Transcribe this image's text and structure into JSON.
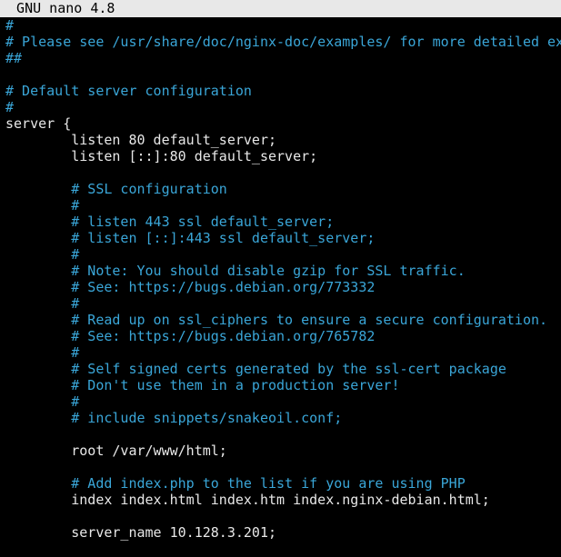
{
  "title_bar": {
    "text": "  GNU nano 4.8"
  },
  "colors": {
    "background": "#000000",
    "title_bar_bg": "#e8e8e8",
    "title_bar_fg": "#000000",
    "code_text": "#e8e8e8",
    "comment_text": "#3aa6d8"
  },
  "editor": {
    "lines": [
      {
        "text": "#",
        "type": "comment"
      },
      {
        "text": "# Please see /usr/share/doc/nginx-doc/examples/ for more detailed ex",
        "type": "comment"
      },
      {
        "text": "##",
        "type": "comment"
      },
      {
        "text": "",
        "type": "code"
      },
      {
        "text": "# Default server configuration",
        "type": "comment"
      },
      {
        "text": "#",
        "type": "comment"
      },
      {
        "text": "server {",
        "type": "code"
      },
      {
        "text": "        listen 80 default_server;",
        "type": "code"
      },
      {
        "text": "        listen [::]:80 default_server;",
        "type": "code"
      },
      {
        "text": "",
        "type": "code"
      },
      {
        "text": "        # SSL configuration",
        "type": "comment"
      },
      {
        "text": "        #",
        "type": "comment"
      },
      {
        "text": "        # listen 443 ssl default_server;",
        "type": "comment"
      },
      {
        "text": "        # listen [::]:443 ssl default_server;",
        "type": "comment"
      },
      {
        "text": "        #",
        "type": "comment"
      },
      {
        "text": "        # Note: You should disable gzip for SSL traffic.",
        "type": "comment"
      },
      {
        "text": "        # See: https://bugs.debian.org/773332",
        "type": "comment"
      },
      {
        "text": "        #",
        "type": "comment"
      },
      {
        "text": "        # Read up on ssl_ciphers to ensure a secure configuration.",
        "type": "comment"
      },
      {
        "text": "        # See: https://bugs.debian.org/765782",
        "type": "comment"
      },
      {
        "text": "        #",
        "type": "comment"
      },
      {
        "text": "        # Self signed certs generated by the ssl-cert package",
        "type": "comment"
      },
      {
        "text": "        # Don't use them in a production server!",
        "type": "comment"
      },
      {
        "text": "        #",
        "type": "comment"
      },
      {
        "text": "        # include snippets/snakeoil.conf;",
        "type": "comment"
      },
      {
        "text": "",
        "type": "code"
      },
      {
        "text": "        root /var/www/html;",
        "type": "code"
      },
      {
        "text": "",
        "type": "code"
      },
      {
        "text": "        # Add index.php to the list if you are using PHP",
        "type": "comment"
      },
      {
        "text": "        index index.html index.htm index.nginx-debian.html;",
        "type": "code"
      },
      {
        "text": "",
        "type": "code"
      },
      {
        "text": "        server_name 10.128.3.201;",
        "type": "code"
      },
      {
        "text": "",
        "type": "code"
      }
    ]
  }
}
